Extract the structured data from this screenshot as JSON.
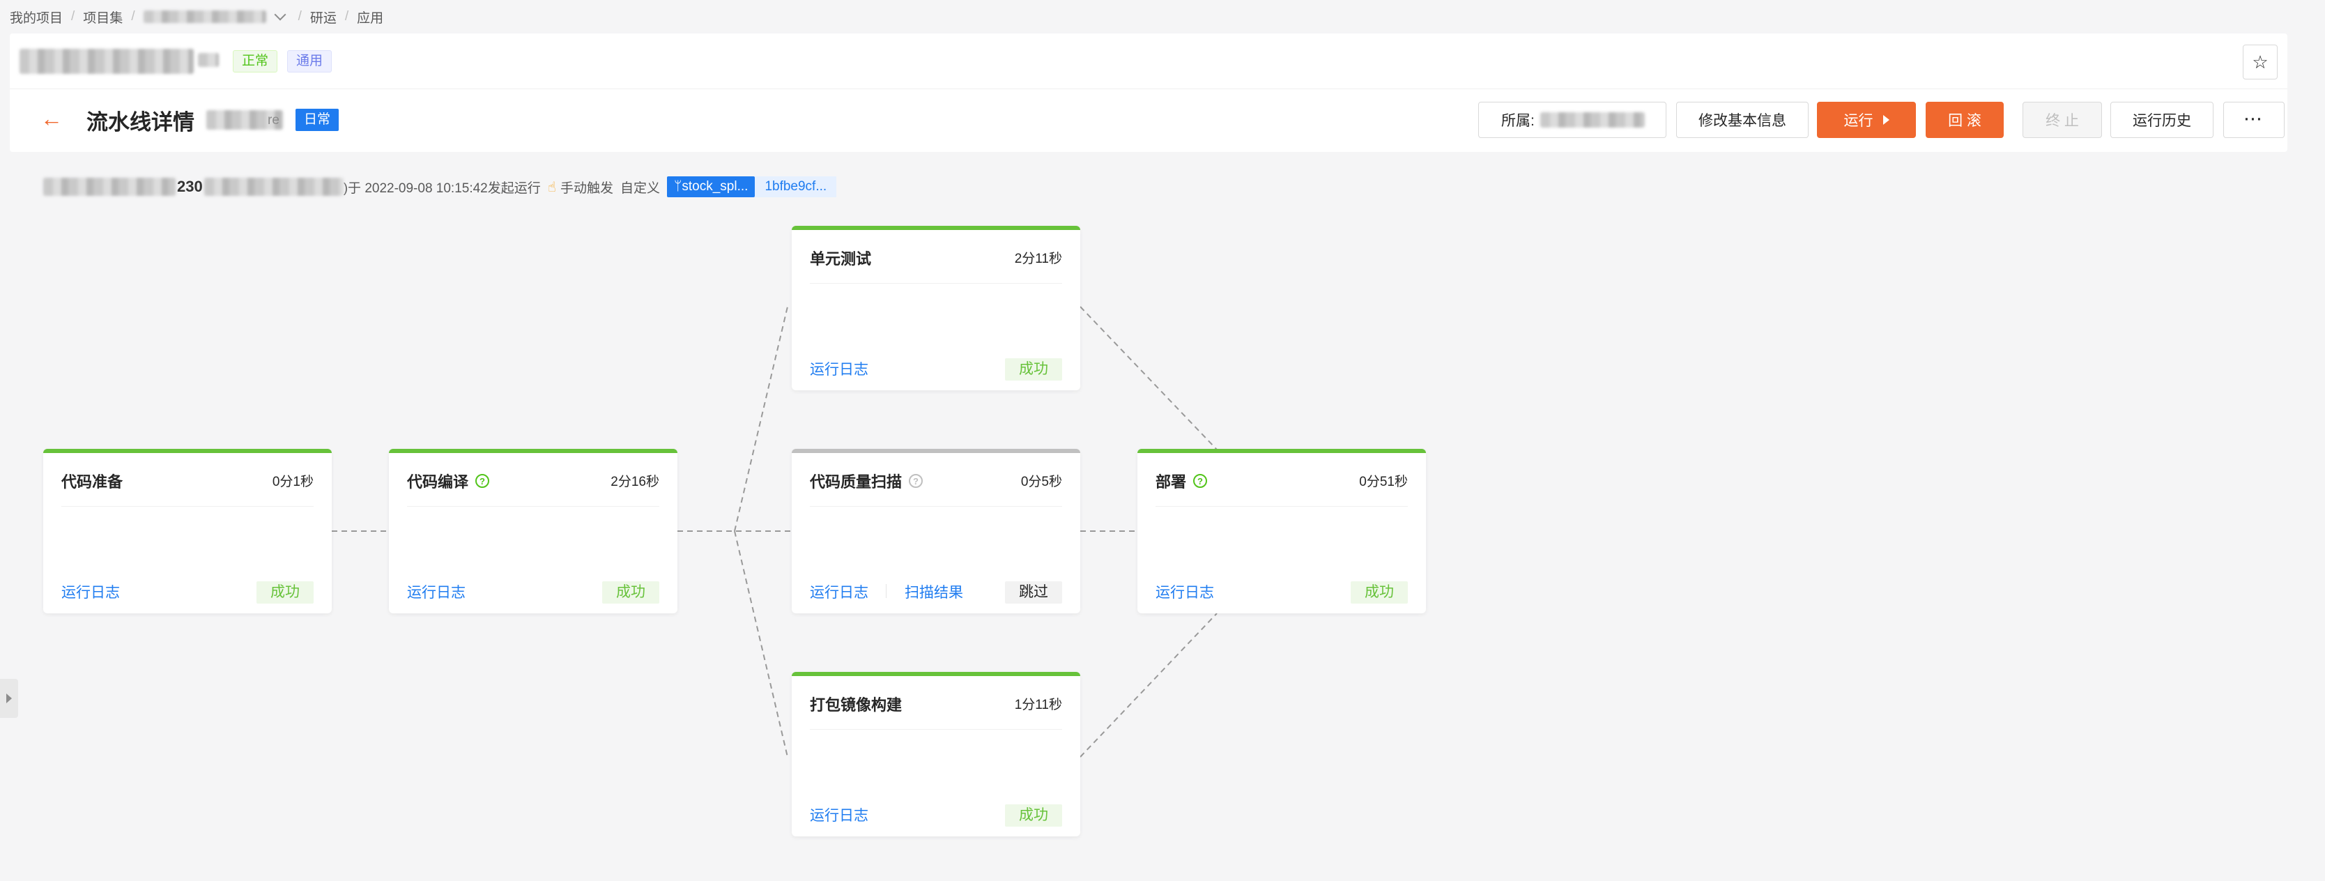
{
  "breadcrumb": {
    "my_projects": "我的项目",
    "project_set": "项目集",
    "research_ops": "研运",
    "application": "应用"
  },
  "project": {
    "tag_normal": "正常",
    "tag_general": "通用"
  },
  "header": {
    "title": "流水线详情",
    "title_suffix": "re",
    "tag_daily": "日常",
    "owner_label": "所属:",
    "edit_label": "修改基本信息",
    "run_label": "运行",
    "rollback_label": "回 滚",
    "stop_label": "终 止",
    "history_label": "运行历史",
    "more_label": "···"
  },
  "run_info": {
    "id_fragment": "230",
    "text": ")于 2022-09-08 10:15:42发起运行",
    "trigger": "手动触发",
    "custom": "自定义",
    "branch": "stock_spl...",
    "commit": "1bfbe9cf..."
  },
  "stages": [
    {
      "id": "prepare",
      "title": "代码准备",
      "time": "0分1秒",
      "link": "运行日志",
      "status": "成功",
      "help": false
    },
    {
      "id": "compile",
      "title": "代码编译",
      "time": "2分16秒",
      "link": "运行日志",
      "status": "成功",
      "help": true
    },
    {
      "id": "unit-test",
      "title": "单元测试",
      "time": "2分11秒",
      "link": "运行日志",
      "status": "成功",
      "help": false
    },
    {
      "id": "scan",
      "title": "代码质量扫描",
      "time": "0分5秒",
      "link": "运行日志",
      "link2": "扫描结果",
      "status": "跳过",
      "help": true
    },
    {
      "id": "image-build",
      "title": "打包镜像构建",
      "time": "1分11秒",
      "link": "运行日志",
      "status": "成功",
      "help": false
    },
    {
      "id": "deploy",
      "title": "部署",
      "time": "0分51秒",
      "link": "运行日志",
      "status": "成功",
      "help": true
    }
  ],
  "colors": {
    "accent": "#f0682e",
    "primary": "#1f7cf0",
    "success": "#67c23a",
    "skipped_border": "#c0c0c0"
  }
}
